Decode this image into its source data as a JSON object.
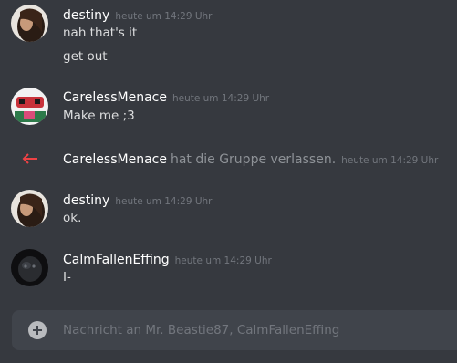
{
  "messages": [
    {
      "author": "destiny",
      "timestamp": "heute um 14:29 Uhr",
      "lines": [
        "nah that's it",
        "get out"
      ]
    },
    {
      "author": "CarelessMenace",
      "timestamp": "heute um 14:29 Uhr",
      "lines": [
        "Make me ;3"
      ]
    },
    {
      "system": true,
      "author": "CarelessMenace",
      "action": "hat die Gruppe verlassen.",
      "timestamp": "heute um 14:29 Uhr"
    },
    {
      "author": "destiny",
      "timestamp": "heute um 14:29 Uhr",
      "lines": [
        "ok."
      ]
    },
    {
      "author": "CalmFallenEffing",
      "timestamp": "heute um 14:29 Uhr",
      "lines": [
        "I-"
      ]
    }
  ],
  "composer": {
    "placeholder": "Nachricht an Mr. Beastie87, CalmFallenEffing"
  },
  "colors": {
    "background": "#36393f",
    "composer_background": "#40444b",
    "leave_arrow": "#ed4245"
  },
  "icons": {
    "attach": "plus-circle-icon",
    "leave": "arrow-left-icon"
  }
}
